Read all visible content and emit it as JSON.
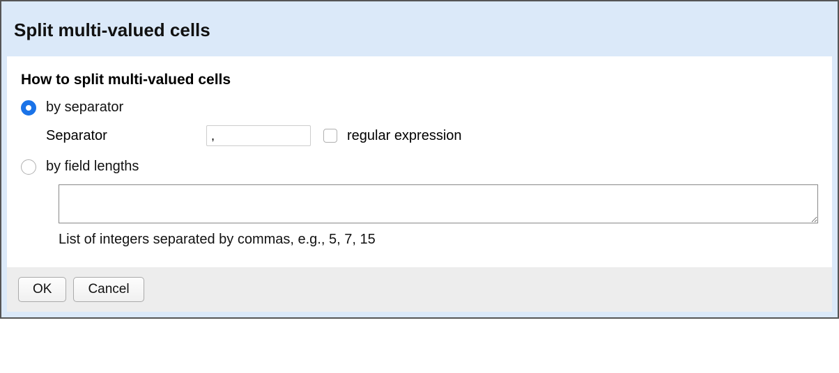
{
  "dialog": {
    "title": "Split multi-valued cells",
    "subheading": "How to split multi-valued cells",
    "option_separator": {
      "label": "by separator",
      "selected": true,
      "separator_label": "Separator",
      "separator_value": ",",
      "regex_checked": false,
      "regex_label": "regular expression"
    },
    "option_lengths": {
      "label": "by field lengths",
      "selected": false,
      "textarea_value": "",
      "hint": "List of integers separated by commas, e.g., 5, 7, 15"
    },
    "buttons": {
      "ok": "OK",
      "cancel": "Cancel"
    }
  }
}
